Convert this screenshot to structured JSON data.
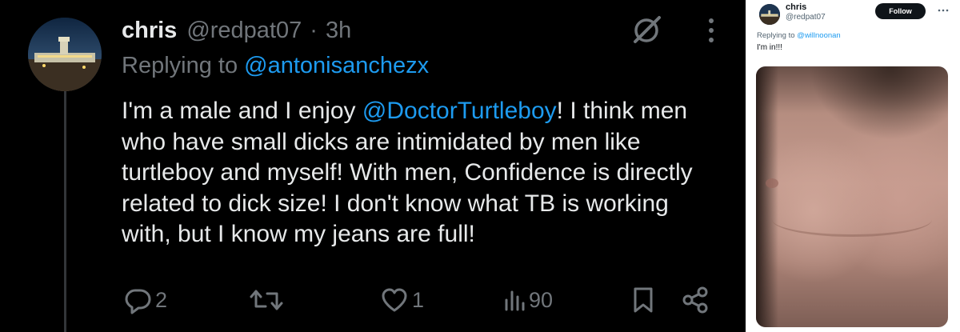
{
  "left_tweet": {
    "author_name": "chris",
    "author_handle": "@redpat07",
    "separator": "·",
    "time": "3h",
    "replying_prefix": "Replying to ",
    "replying_to": "@antonisanchezx",
    "text_before_mention": "I'm a male and I enjoy ",
    "text_mention": "@DoctorTurtleboy",
    "text_after_mention": "! I think men who have small dicks are intimidated by men like turtleboy and myself! With men, Confidence is directly related to dick size! I don't know what TB is working with, but I know my jeans are full!",
    "reply_count": "2",
    "retweet_count": "",
    "like_count": "1",
    "view_count": "90",
    "accent_color": "#1d9bf0",
    "muted_color": "#71767b",
    "icons": [
      "grok-icon",
      "more-icon",
      "reply-icon",
      "retweet-icon",
      "like-icon",
      "views-icon",
      "bookmark-icon",
      "share-icon"
    ]
  },
  "right_tweet": {
    "author_name": "chris",
    "author_handle": "@redpat07",
    "follow_label": "Follow",
    "replying_prefix": "Replying to ",
    "replying_to": "@willnoonan",
    "text": "I'm in!!!",
    "has_photo": true
  }
}
